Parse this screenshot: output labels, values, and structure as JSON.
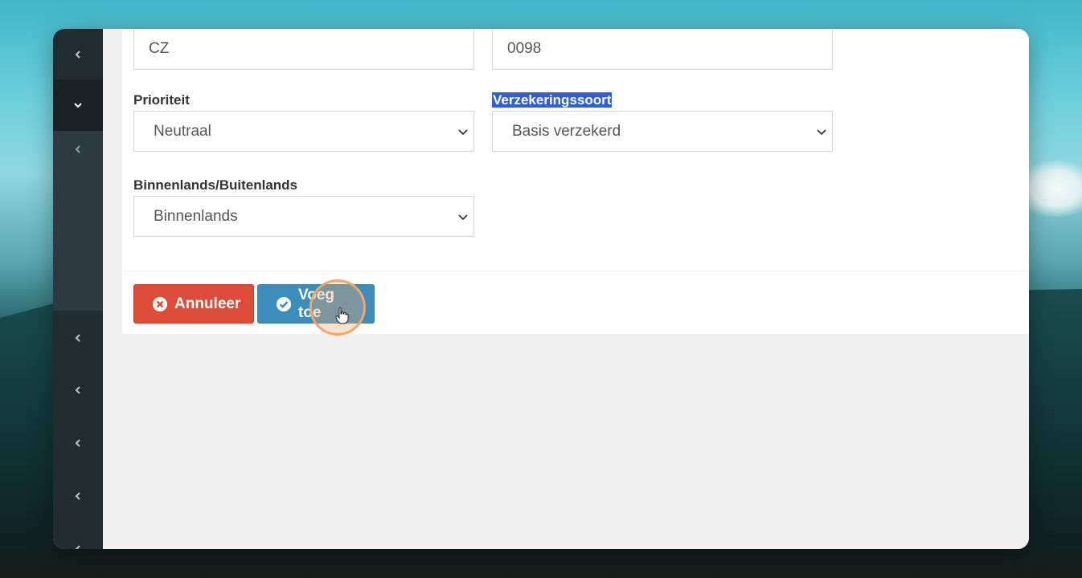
{
  "form": {
    "insurer_value": "CZ",
    "code_value": "0098",
    "priority_label": "Prioriteit",
    "priority_value": "Neutraal",
    "insurance_type_label": "Verzekeringssoort",
    "insurance_type_value": "Basis verzekerd",
    "domestic_label": "Binnenlands/Buitenlands",
    "domestic_value": "Binnenlands"
  },
  "actions": {
    "cancel_label": "Annuleer",
    "add_label": "Voeg toe"
  },
  "icons": {
    "sidebar": "chevron-left-icon",
    "sidebar_active": "chevron-down-icon",
    "select": "chevron-down-icon",
    "cancel": "times-circle-icon",
    "add": "check-circle-icon"
  },
  "colors": {
    "sidebar": "#222d32",
    "danger": "#dd4b39",
    "primary": "#3c8dbc",
    "highlight": "#2f5fd0"
  }
}
